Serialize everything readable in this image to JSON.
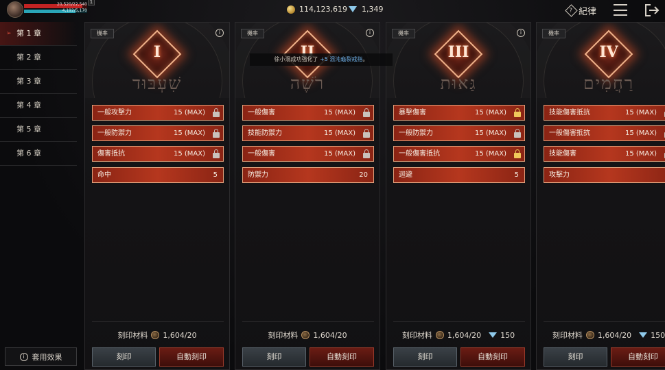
{
  "player": {
    "hp": "20,520/22,540",
    "mp": "4,192/5,170",
    "level_badge": "1"
  },
  "currency": {
    "gold": "114,123,619",
    "gems": "1,349"
  },
  "header": {
    "discipline_label": "紀律"
  },
  "sidebar": {
    "chapters": [
      {
        "label": "第 1 章",
        "active": true
      },
      {
        "label": "第 2 章",
        "active": false
      },
      {
        "label": "第 3 章",
        "active": false
      },
      {
        "label": "第 4 章",
        "active": false
      },
      {
        "label": "第 5 章",
        "active": false
      },
      {
        "label": "第 6 章",
        "active": false
      }
    ],
    "apply_effect_label": "套用效果"
  },
  "toast": {
    "prefix": "徐小混成功強化了",
    "item": "+5 混沌龜裂戒指",
    "suffix": "。"
  },
  "cards": [
    {
      "probability_label": "機率",
      "numeral": "I",
      "hebrew": "שִׁעְבּוּד",
      "stats": [
        {
          "name": "一般攻擊力",
          "value": "15 (MAX)",
          "lock": "silver"
        },
        {
          "name": "一般防禦力",
          "value": "15 (MAX)",
          "lock": "silver"
        },
        {
          "name": "傷害抵抗",
          "value": "15 (MAX)",
          "lock": "silver"
        }
      ],
      "extra": {
        "name": "命中",
        "value": "5"
      },
      "material_label": "刻印材料",
      "material_value": "1,604/20",
      "gem_cost": "",
      "engrave_label": "刻印",
      "auto_label": "自動刻印"
    },
    {
      "probability_label": "機率",
      "numeral": "II",
      "hebrew": "רֹשֶׁה",
      "stats": [
        {
          "name": "一般傷害",
          "value": "15 (MAX)",
          "lock": "silver"
        },
        {
          "name": "技能防禦力",
          "value": "15 (MAX)",
          "lock": "silver"
        },
        {
          "name": "一般傷害",
          "value": "15 (MAX)",
          "lock": "silver"
        }
      ],
      "extra": {
        "name": "防禦力",
        "value": "20"
      },
      "material_label": "刻印材料",
      "material_value": "1,604/20",
      "gem_cost": "",
      "engrave_label": "刻印",
      "auto_label": "自動刻印"
    },
    {
      "probability_label": "機率",
      "numeral": "III",
      "hebrew": "גַּאוּת",
      "stats": [
        {
          "name": "暴擊傷害",
          "value": "15 (MAX)",
          "lock": "gold"
        },
        {
          "name": "一般防禦力",
          "value": "15 (MAX)",
          "lock": "silver"
        },
        {
          "name": "一般傷害抵抗",
          "value": "15 (MAX)",
          "lock": "gold"
        }
      ],
      "extra": {
        "name": "迴避",
        "value": "5"
      },
      "material_label": "刻印材料",
      "material_value": "1,604/20",
      "gem_cost": "150",
      "engrave_label": "刻印",
      "auto_label": "自動刻印"
    },
    {
      "probability_label": "機率",
      "numeral": "IV",
      "hebrew": "רַחֲמִים",
      "stats": [
        {
          "name": "技能傷害抵抗",
          "value": "15 (MAX)",
          "lock": "silver"
        },
        {
          "name": "一般傷害抵抗",
          "value": "15 (MAX)",
          "lock": "silver"
        },
        {
          "name": "技能傷害",
          "value": "15 (MAX)",
          "lock": "silver"
        }
      ],
      "extra": {
        "name": "攻擊力",
        "value": ""
      },
      "material_label": "刻印材料",
      "material_value": "1,604/20",
      "gem_cost": "150",
      "engrave_label": "刻印",
      "auto_label": "自動刻印"
    }
  ]
}
